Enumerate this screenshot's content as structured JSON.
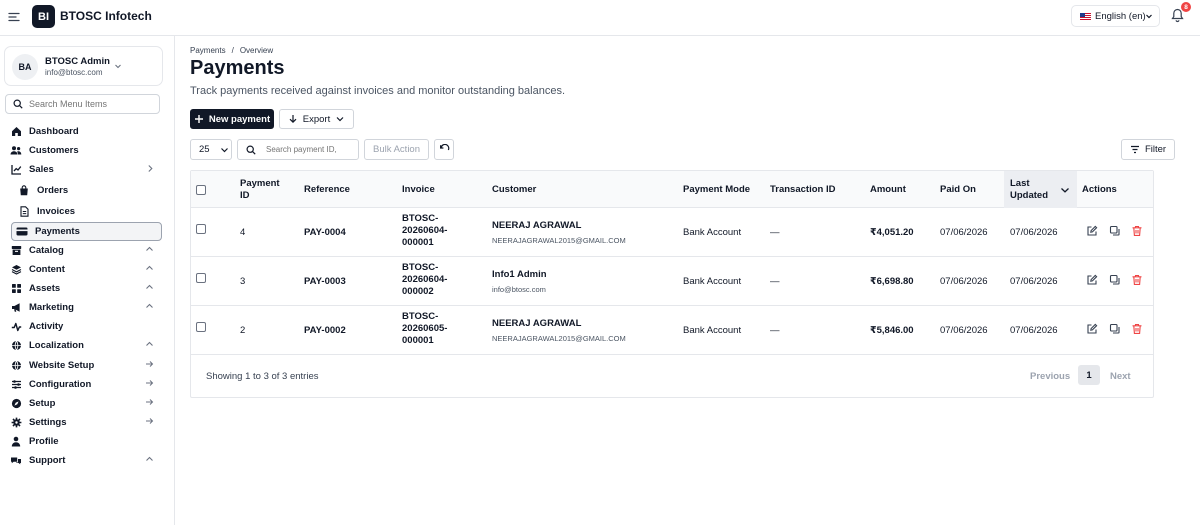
{
  "app": {
    "brand_initials": "BI",
    "brand_name": "BTOSC Infotech",
    "language": "English (en)",
    "notification_count": "8"
  },
  "user": {
    "initials": "BA",
    "name": "BTOSC Admin",
    "email": "info@btosc.com"
  },
  "sidebar": {
    "search_placeholder": "Search Menu Items",
    "items": [
      {
        "label": "Dashboard",
        "icon": "home-icon"
      },
      {
        "label": "Customers",
        "icon": "users-icon"
      },
      {
        "label": "Sales",
        "icon": "chart-icon",
        "trail": "chevron-right"
      },
      {
        "label": "Orders",
        "icon": "bag-icon",
        "sub": true
      },
      {
        "label": "Invoices",
        "icon": "document-icon",
        "sub": true
      },
      {
        "label": "Payments",
        "icon": "card-icon",
        "sub": true,
        "active": true
      },
      {
        "label": "Catalog",
        "icon": "box-icon",
        "trail": "chevron-up"
      },
      {
        "label": "Content",
        "icon": "layers-icon",
        "trail": "chevron-up"
      },
      {
        "label": "Assets",
        "icon": "grid-icon",
        "trail": "chevron-up"
      },
      {
        "label": "Marketing",
        "icon": "megaphone-icon",
        "trail": "chevron-up"
      },
      {
        "label": "Activity",
        "icon": "activity-icon"
      },
      {
        "label": "Localization",
        "icon": "globe-icon",
        "trail": "chevron-up"
      },
      {
        "label": "Website Setup",
        "icon": "globe-icon",
        "trail": "arrow-right"
      },
      {
        "label": "Configuration",
        "icon": "sliders-icon",
        "trail": "arrow-right"
      },
      {
        "label": "Setup",
        "icon": "compass-icon",
        "trail": "arrow-right"
      },
      {
        "label": "Settings",
        "icon": "gear-icon",
        "trail": "arrow-right"
      },
      {
        "label": "Profile",
        "icon": "user-icon"
      },
      {
        "label": "Support",
        "icon": "support-icon",
        "trail": "chevron-up"
      }
    ]
  },
  "breadcrumb": {
    "parent": "Payments",
    "separator": "/",
    "current": "Overview"
  },
  "page": {
    "title": "Payments",
    "subtitle": "Track payments received against invoices and monitor outstanding balances."
  },
  "toolbar": {
    "new_payment": "New payment",
    "export": "Export",
    "page_size": "25",
    "search_placeholder": "Search payment ID,",
    "bulk_action": "Bulk Action",
    "filter": "Filter"
  },
  "table": {
    "columns": {
      "payment_id": "Payment ID",
      "reference": "Reference",
      "invoice": "Invoice",
      "customer": "Customer",
      "payment_mode": "Payment Mode",
      "transaction_id": "Transaction ID",
      "amount": "Amount",
      "paid_on": "Paid On",
      "last_updated": "Last Updated",
      "actions": "Actions"
    },
    "rows": [
      {
        "id": "4",
        "reference": "PAY-0004",
        "invoice": [
          "BTOSC-",
          "20260604-",
          "000001"
        ],
        "customer_name": "NEERAJ AGRAWAL",
        "customer_email": "NEERAJAGRAWAL2015@GMAIL.COM",
        "mode": "Bank Account",
        "txn": "—",
        "amount": "₹4,051.20",
        "paid_on": "07/06/2026",
        "updated": "07/06/2026"
      },
      {
        "id": "3",
        "reference": "PAY-0003",
        "invoice": [
          "BTOSC-",
          "20260604-",
          "000002"
        ],
        "customer_name": "Info1 Admin",
        "customer_email": "info@btosc.com",
        "mode": "Bank Account",
        "txn": "—",
        "amount": "₹6,698.80",
        "paid_on": "07/06/2026",
        "updated": "07/06/2026"
      },
      {
        "id": "2",
        "reference": "PAY-0002",
        "invoice": [
          "BTOSC-",
          "20260605-",
          "000001"
        ],
        "customer_name": "NEERAJ AGRAWAL",
        "customer_email": "NEERAJAGRAWAL2015@GMAIL.COM",
        "mode": "Bank Account",
        "txn": "—",
        "amount": "₹5,846.00",
        "paid_on": "07/06/2026",
        "updated": "07/06/2026"
      }
    ],
    "footer": "Showing 1 to 3 of 3 entries",
    "pager": {
      "previous": "Previous",
      "current": "1",
      "next": "Next"
    }
  },
  "colors": {
    "primary": "#111827",
    "danger": "#ef4444",
    "border": "#e5e7eb"
  }
}
